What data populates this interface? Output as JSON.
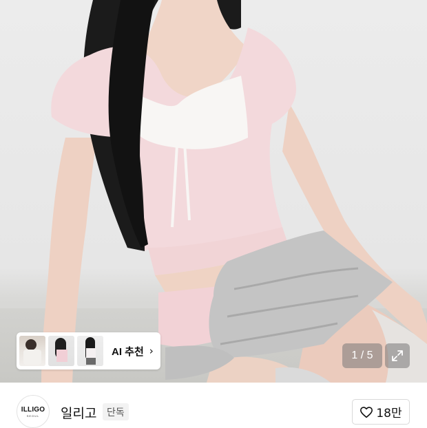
{
  "product_image": {
    "description_icon": "model-photo",
    "page_counter": "1 / 5"
  },
  "ai_recommend": {
    "label": "AI 추천",
    "chevron": "›",
    "thumbnails": [
      "thumb-1",
      "thumb-2",
      "thumb-3"
    ]
  },
  "shop": {
    "logo_text": "ILLIGO",
    "logo_subtext": "SEOUL",
    "name": "일리고",
    "badge": "단독"
  },
  "like": {
    "count": "18만"
  },
  "colors": {
    "pink_top": "#f3d9dc",
    "skirt_gray": "#bdbdbd",
    "hair": "#1a1a1a",
    "skin": "#efd3c4"
  }
}
